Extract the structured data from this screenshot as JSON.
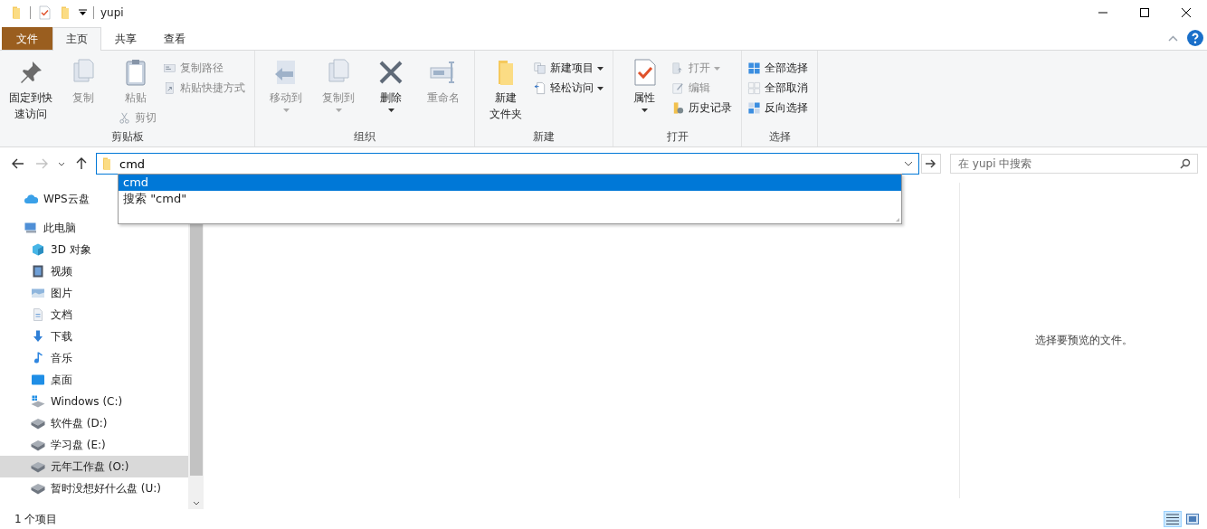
{
  "window": {
    "title": "yupi"
  },
  "tabs": [
    {
      "label": "文件",
      "kind": "file",
      "selected": false
    },
    {
      "label": "主页",
      "kind": "tab",
      "selected": true
    },
    {
      "label": "共享",
      "kind": "tab",
      "selected": false
    },
    {
      "label": "查看",
      "kind": "tab",
      "selected": false
    }
  ],
  "ribbon": {
    "groups": [
      {
        "label": "剪贴板",
        "items": [
          {
            "kind": "large",
            "label": [
              "固定到快",
              "速访问"
            ],
            "disabled": false,
            "dropdown": false
          },
          {
            "kind": "large",
            "label": "复制",
            "disabled": true,
            "dropdown": false
          },
          {
            "kind": "large",
            "label": "粘贴",
            "disabled": true,
            "dropdown": false,
            "sub": {
              "label": "剪切",
              "disabled": true
            }
          },
          {
            "kind": "stack",
            "items": [
              {
                "label": "复制路径",
                "disabled": true,
                "dropdown": false
              },
              {
                "label": "粘贴快捷方式",
                "disabled": true,
                "dropdown": false
              }
            ]
          }
        ]
      },
      {
        "label": "组织",
        "items": [
          {
            "kind": "large",
            "label": "移动到",
            "disabled": true,
            "dropdown": true
          },
          {
            "kind": "large",
            "label": "复制到",
            "disabled": true,
            "dropdown": true
          },
          {
            "kind": "large",
            "label": "删除",
            "disabled": false,
            "dropdown": true
          },
          {
            "kind": "large",
            "label": "重命名",
            "disabled": true,
            "dropdown": false
          }
        ]
      },
      {
        "label": "新建",
        "items": [
          {
            "kind": "large",
            "label": [
              "新建",
              "文件夹"
            ],
            "disabled": false,
            "dropdown": false
          },
          {
            "kind": "stack",
            "items": [
              {
                "label": "新建项目",
                "disabled": false,
                "dropdown": true
              },
              {
                "label": "轻松访问",
                "disabled": false,
                "dropdown": true
              }
            ]
          }
        ]
      },
      {
        "label": "打开",
        "items": [
          {
            "kind": "large",
            "label": "属性",
            "disabled": false,
            "dropdown": true
          },
          {
            "kind": "stack",
            "items": [
              {
                "label": "打开",
                "disabled": true,
                "dropdown": true
              },
              {
                "label": "编辑",
                "disabled": true,
                "dropdown": false
              },
              {
                "label": "历史记录",
                "disabled": false,
                "dropdown": false
              }
            ]
          }
        ]
      },
      {
        "label": "选择",
        "items": [
          {
            "kind": "stack",
            "items": [
              {
                "label": "全部选择",
                "disabled": false,
                "dropdown": false
              },
              {
                "label": "全部取消",
                "disabled": false,
                "dropdown": false
              },
              {
                "label": "反向选择",
                "disabled": false,
                "dropdown": false
              }
            ]
          }
        ]
      }
    ]
  },
  "address": {
    "value": "cmd",
    "suggestions": [
      {
        "label": "cmd",
        "selected": true
      },
      {
        "label": "搜索 \"cmd\"",
        "selected": false
      }
    ]
  },
  "search": {
    "placeholder": "在 yupi 中搜索"
  },
  "nav": {
    "items": [
      {
        "label": "WPS云盘",
        "selected": false
      },
      {
        "label": "此电脑",
        "selected": false,
        "children": [
          {
            "label": "3D 对象",
            "selected": false
          },
          {
            "label": "视频",
            "selected": false
          },
          {
            "label": "图片",
            "selected": false
          },
          {
            "label": "文档",
            "selected": false
          },
          {
            "label": "下载",
            "selected": false
          },
          {
            "label": "音乐",
            "selected": false
          },
          {
            "label": "桌面",
            "selected": false
          },
          {
            "label": "Windows (C:)",
            "selected": false
          },
          {
            "label": "软件盘 (D:)",
            "selected": false
          },
          {
            "label": "学习盘 (E:)",
            "selected": false
          },
          {
            "label": "元年工作盘 (O:)",
            "selected": true
          },
          {
            "label": "暂时没想好什么盘 (U:)",
            "selected": false
          }
        ]
      }
    ]
  },
  "preview": {
    "message": "选择要预览的文件。"
  },
  "status_bar": {
    "text": "1 个项目",
    "views": [
      {
        "kind": "details",
        "selected": true
      },
      {
        "kind": "large-icons",
        "selected": false
      }
    ]
  }
}
